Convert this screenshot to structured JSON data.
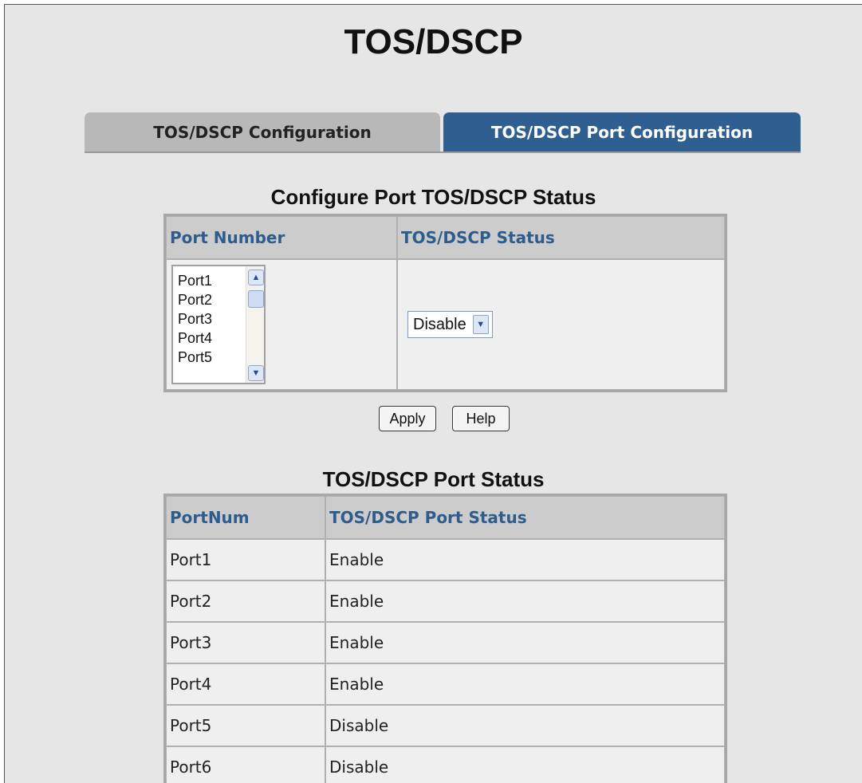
{
  "page": {
    "title": "TOS/DSCP"
  },
  "tabs": [
    {
      "label": "TOS/DSCP Configuration",
      "active": false
    },
    {
      "label": "TOS/DSCP Port Configuration",
      "active": true
    }
  ],
  "config": {
    "title": "Configure Port TOS/DSCP Status",
    "col_port": "Port Number",
    "col_status": "TOS/DSCP Status",
    "ports": [
      "Port1",
      "Port2",
      "Port3",
      "Port4",
      "Port5"
    ],
    "status_value": "Disable"
  },
  "buttons": {
    "apply": "Apply",
    "help": "Help"
  },
  "status": {
    "title": "TOS/DSCP Port Status",
    "col_portnum": "PortNum",
    "col_status": "TOS/DSCP Port Status",
    "rows": [
      {
        "port": "Port1",
        "status": "Enable"
      },
      {
        "port": "Port2",
        "status": "Enable"
      },
      {
        "port": "Port3",
        "status": "Enable"
      },
      {
        "port": "Port4",
        "status": "Enable"
      },
      {
        "port": "Port5",
        "status": "Disable"
      },
      {
        "port": "Port6",
        "status": "Disable"
      }
    ]
  },
  "colors": {
    "active_tab": "#2f5f91",
    "header_text": "#2e5c8c",
    "background": "#e6e6e6"
  }
}
